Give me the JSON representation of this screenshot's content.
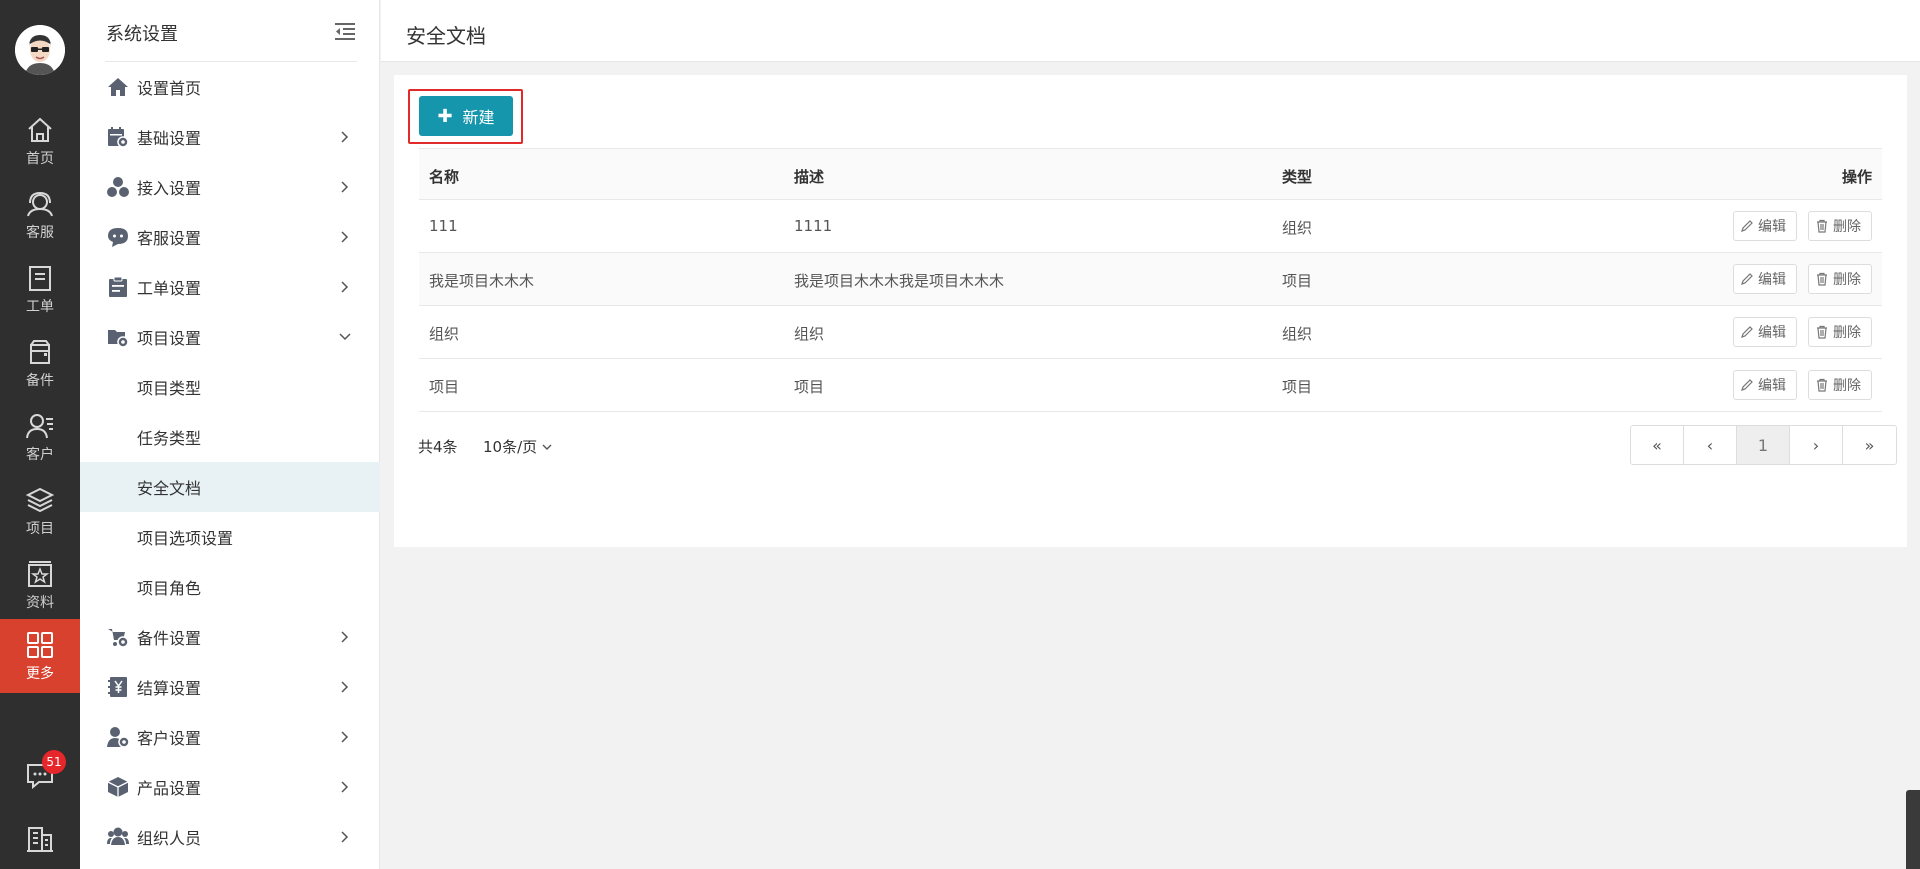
{
  "rail": {
    "items": [
      {
        "label": "首页",
        "icon": "home-icon"
      },
      {
        "label": "客服",
        "icon": "headset-icon"
      },
      {
        "label": "工单",
        "icon": "clipboard-icon"
      },
      {
        "label": "备件",
        "icon": "box-icon"
      },
      {
        "label": "客户",
        "icon": "customer-icon"
      },
      {
        "label": "项目",
        "icon": "layers-icon"
      },
      {
        "label": "资料",
        "icon": "star-doc-icon"
      },
      {
        "label": "更多",
        "icon": "grid-icon"
      }
    ],
    "message_badge": "51",
    "active_color": "#d9412f"
  },
  "sidebar": {
    "title": "系统设置",
    "items": [
      {
        "label": "设置首页"
      },
      {
        "label": "基础设置"
      },
      {
        "label": "接入设置"
      },
      {
        "label": "客服设置"
      },
      {
        "label": "工单设置"
      },
      {
        "label": "项目设置"
      },
      {
        "label": "项目类型"
      },
      {
        "label": "任务类型"
      },
      {
        "label": "安全文档"
      },
      {
        "label": "项目选项设置"
      },
      {
        "label": "项目角色"
      },
      {
        "label": "备件设置"
      },
      {
        "label": "结算设置"
      },
      {
        "label": "客户设置"
      },
      {
        "label": "产品设置"
      },
      {
        "label": "组织人员"
      }
    ]
  },
  "page": {
    "title": "安全文档",
    "new_button": "新建"
  },
  "table": {
    "headers": [
      "名称",
      "描述",
      "类型",
      "操作"
    ],
    "rows": [
      {
        "name": "111",
        "desc": "1111",
        "type": "组织"
      },
      {
        "name": "我是项目木木木",
        "desc": "我是项目木木木我是项目木木木",
        "type": "项目"
      },
      {
        "name": "组织",
        "desc": "组织",
        "type": "组织"
      },
      {
        "name": "项目",
        "desc": "项目",
        "type": "项目"
      }
    ],
    "edit_label": "编辑",
    "delete_label": "删除"
  },
  "pagination": {
    "total": "共4条",
    "page_size": "10条/页",
    "first": "«",
    "prev": "‹",
    "current": "1",
    "next": "›",
    "last": "»"
  },
  "colors": {
    "primary": "#1596ac",
    "highlight_border": "#e12b2b",
    "selected_menu_bg": "#e8f2f4"
  }
}
